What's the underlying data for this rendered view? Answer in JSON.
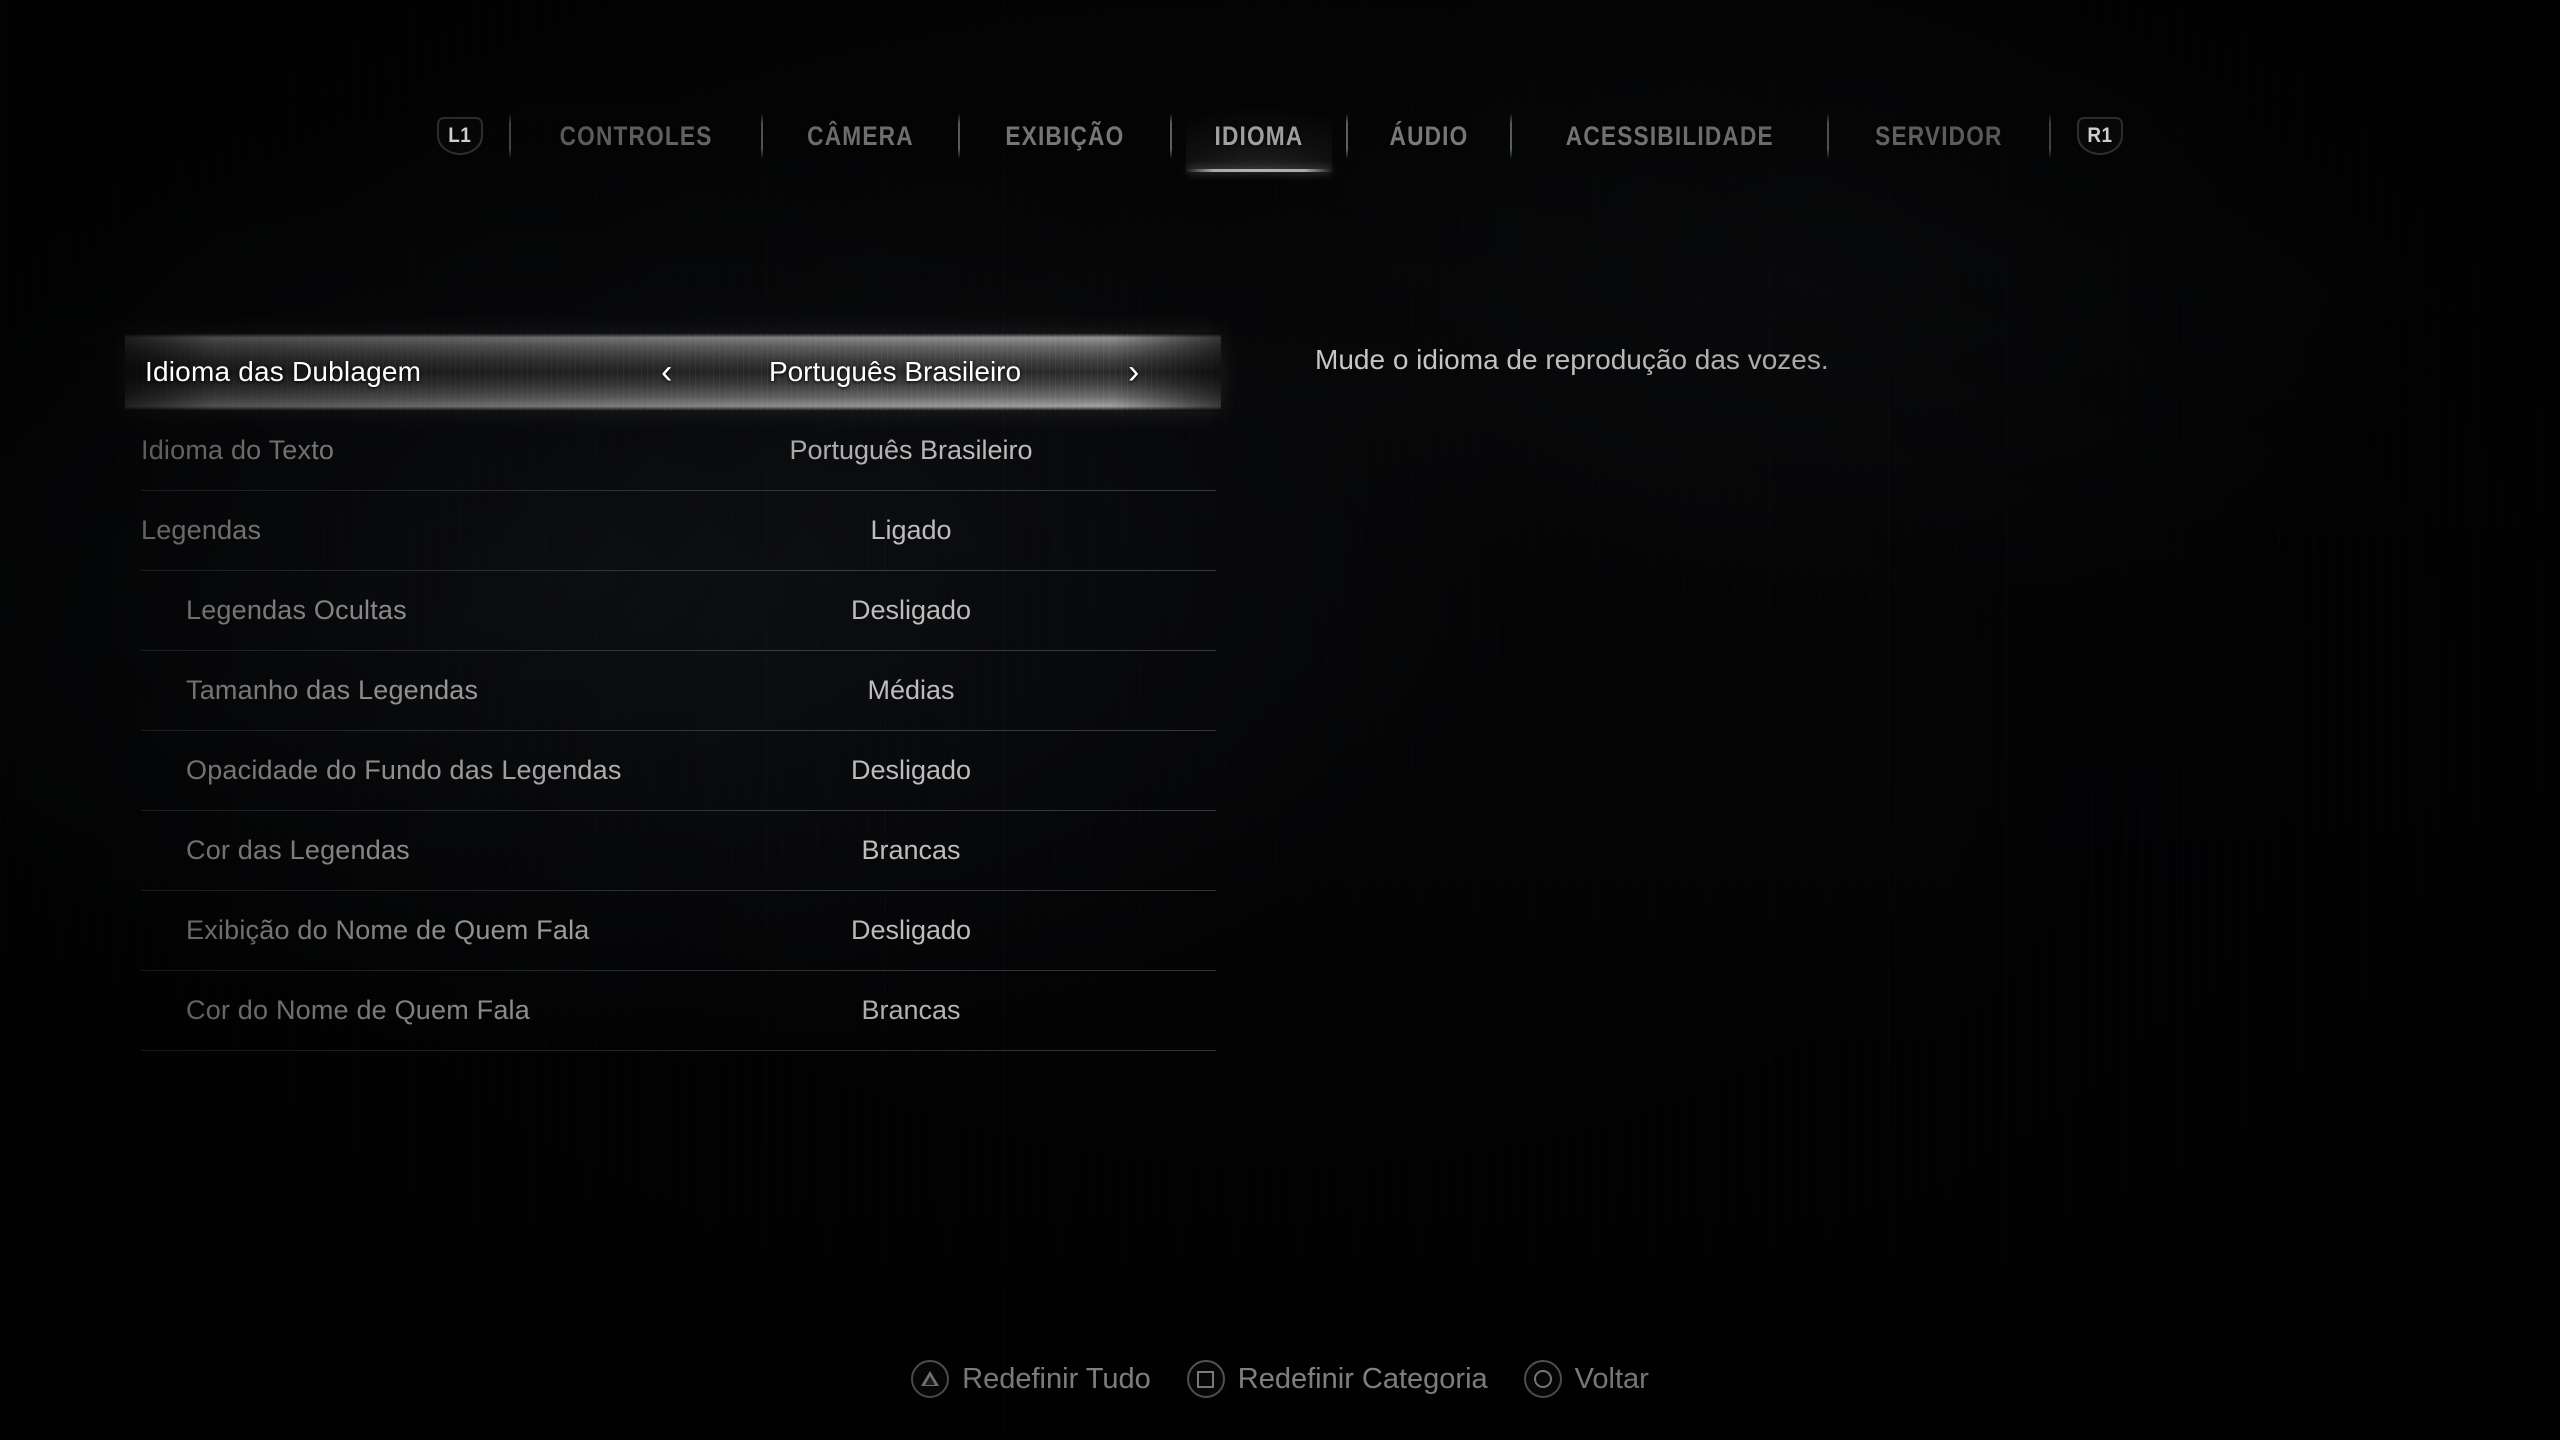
{
  "nav": {
    "left_bumper": "L1",
    "right_bumper": "R1",
    "tabs": [
      {
        "label": "CONTROLES",
        "selected": false
      },
      {
        "label": "CÂMERA",
        "selected": false
      },
      {
        "label": "EXIBIÇÃO",
        "selected": false
      },
      {
        "label": "IDIOMA",
        "selected": true
      },
      {
        "label": "ÁUDIO",
        "selected": false
      },
      {
        "label": "ACESSIBILIDADE",
        "selected": false
      },
      {
        "label": "SERVIDOR",
        "selected": false
      }
    ]
  },
  "settings": {
    "rows": [
      {
        "label": "Idioma das Dublagem",
        "value": "Português Brasileiro",
        "selected": true,
        "indent": false
      },
      {
        "label": "Idioma do Texto",
        "value": "Português Brasileiro",
        "selected": false,
        "indent": false
      },
      {
        "label": "Legendas",
        "value": "Ligado",
        "selected": false,
        "indent": false
      },
      {
        "label": "Legendas Ocultas",
        "value": "Desligado",
        "selected": false,
        "indent": true
      },
      {
        "label": "Tamanho das Legendas",
        "value": "Médias",
        "selected": false,
        "indent": true
      },
      {
        "label": "Opacidade do Fundo das Legendas",
        "value": "Desligado",
        "selected": false,
        "indent": true
      },
      {
        "label": "Cor das Legendas",
        "value": "Brancas",
        "selected": false,
        "indent": true
      },
      {
        "label": "Exibição do Nome de Quem Fala",
        "value": "Desligado",
        "selected": false,
        "indent": true
      },
      {
        "label": "Cor do Nome de Quem Fala",
        "value": "Brancas",
        "selected": false,
        "indent": true
      }
    ],
    "arrow_left": "‹",
    "arrow_right": "›"
  },
  "description": {
    "text": "Mude o idioma de reprodução das vozes."
  },
  "footer": {
    "prompts": [
      {
        "icon": "triangle-button-icon",
        "label": "Redefinir Tudo"
      },
      {
        "icon": "square-button-icon",
        "label": "Redefinir Categoria"
      },
      {
        "icon": "circle-button-icon",
        "label": "Voltar"
      }
    ]
  },
  "colors": {
    "background": "#050505",
    "text_primary": "#c6c6c6",
    "text_selected": "#ffffff",
    "separator": "#a0a2a8"
  }
}
